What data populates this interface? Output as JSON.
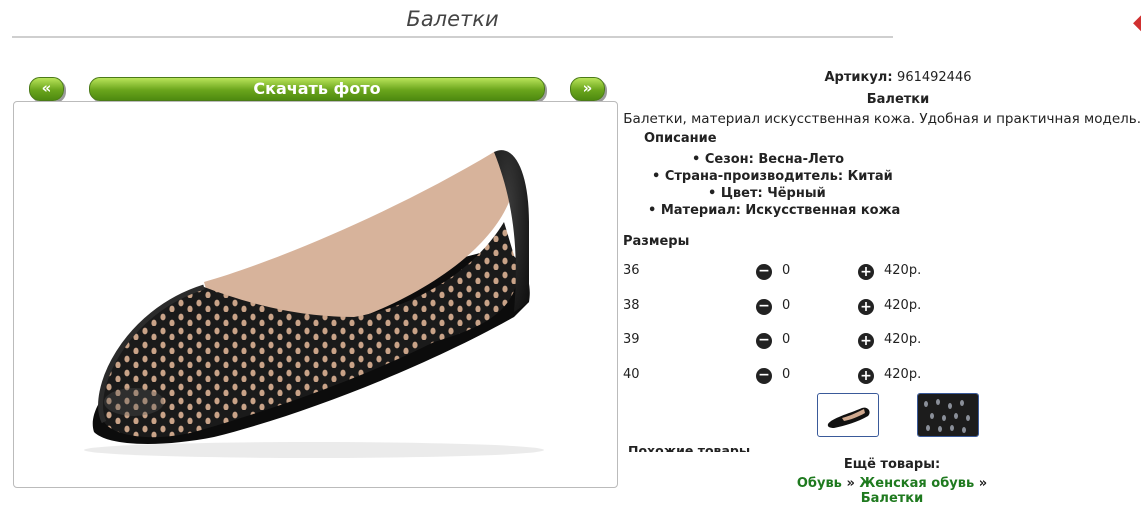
{
  "page": {
    "title": "Балетки",
    "close_icon": "close-icon"
  },
  "gallery": {
    "prev_label": "«",
    "download_label": "Скачать фото",
    "next_label": "»",
    "photo_icon": "shoe-photo"
  },
  "product": {
    "article_label": "Артикул:",
    "article_value": "961492446",
    "name": "Балетки",
    "description": "Балетки, материал искусственная кожа. Удобная и практичная модель.",
    "description_heading": "Описание",
    "features": [
      "Сезон: Весна-Лето",
      "Страна-производитель: Китай",
      "Цвет: Чёрный",
      "Материал: Искусственная кожа"
    ]
  },
  "sizes": {
    "heading": "Размеры",
    "rows": [
      {
        "size": "36",
        "qty": "0",
        "price": "420р."
      },
      {
        "size": "38",
        "qty": "0",
        "price": "420р."
      },
      {
        "size": "39",
        "qty": "0",
        "price": "420р."
      },
      {
        "size": "40",
        "qty": "0",
        "price": "420р."
      }
    ]
  },
  "similar": {
    "heading": "Похожие товары"
  },
  "more": {
    "heading": "Ещё товары:",
    "crumbs": [
      "Обувь",
      "Женская обувь",
      "Балетки"
    ],
    "separator": "»"
  }
}
